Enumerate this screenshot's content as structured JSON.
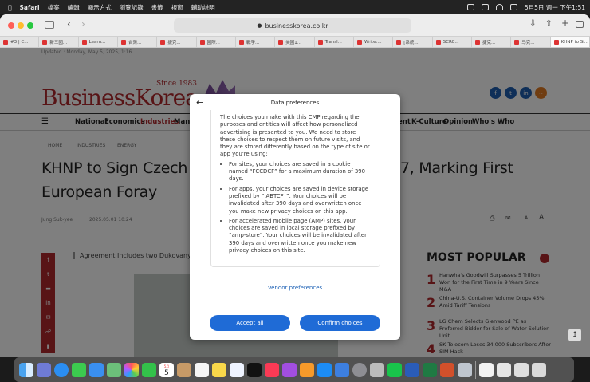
{
  "menubar": {
    "app": "Safari",
    "items": [
      "檔案",
      "編輯",
      "顯示方式",
      "瀏覽記錄",
      "書籤",
      "視窗",
      "輔助說明"
    ],
    "clock": "5月5日 週一 下午1:51"
  },
  "browser": {
    "url": "businesskorea.co.kr",
    "tabs": [
      "#3 | C...",
      "新三國...",
      "Learn...",
      "台灣...",
      "捷克...",
      "國際...",
      "戰爭...",
      "美國1...",
      "Transl...",
      "Write:...",
      "[系統...",
      "SCRC...",
      "捷克...",
      "马克...",
      "KHNP to Si..."
    ]
  },
  "site": {
    "logo": "BusinessKorea",
    "since": "Since 1983",
    "updated": "Updated : Monday, May 5, 2025, 1:16",
    "nav": [
      "National",
      "Economics",
      "Industries",
      "Mana",
      "ent",
      "K-Culture",
      "Opinion",
      "Who's Who"
    ],
    "breadcrumb": [
      "HOME",
      "INDUSTRIES",
      "ENERGY"
    ],
    "headline_line1": "KHNP to Sign Czech Nu",
    "headline_line1_right": "7, Marking First",
    "headline_line2": "European Foray",
    "author": "Jung Suk-yee",
    "date": "2025.05.01 10:24",
    "subhead": "Agreement Includes two Dukovany",
    "font_small": "A",
    "font_large": "A",
    "most_popular_title": "MOST POPULAR",
    "most_popular": [
      {
        "rank": "1",
        "text": "Hanwha's Goodwill Surpasses 5 Trillion Won for the First Time in 9 Years Since M&A"
      },
      {
        "rank": "2",
        "text": "China-U.S. Container Volume Drops 45% Amid Tariff Tensions"
      },
      {
        "rank": "3",
        "text": "LG Chem Selects Glenwood PE as Preferred Bidder for Sale of Water Solution Unit"
      },
      {
        "rank": "4",
        "text": "SK Telecom Loses 34,000 Subscribers After SIM Hack"
      }
    ]
  },
  "dialog": {
    "title": "Data preferences",
    "intro": "The choices you make with this CMP regarding the purposes and entities will affect how personalized advertising is presented to you. We need to store these choices to respect them on future visits, and they are stored differently based on the type of site or app you're using:",
    "bullets": [
      "For sites, your choices are saved in a cookie named “FCCDCF” for a maximum duration of 390 days.",
      "For apps, your choices are saved in device storage prefixed by “IABTCF_”. Your choices will be invalidated after 390 days and overwritten once you make new privacy choices on this app.",
      "For accelerated mobile page (AMP) sites, your choices are saved in local storage prefixed by “amp-store”. Your choices will be invalidated after 390 days and overwritten once you make new privacy choices on this site."
    ],
    "vendor_link": "Vendor preferences",
    "accept_all": "Accept all",
    "confirm": "Confirm choices"
  },
  "dock": {
    "calendar_day": "5",
    "calendar_month": "5月"
  }
}
